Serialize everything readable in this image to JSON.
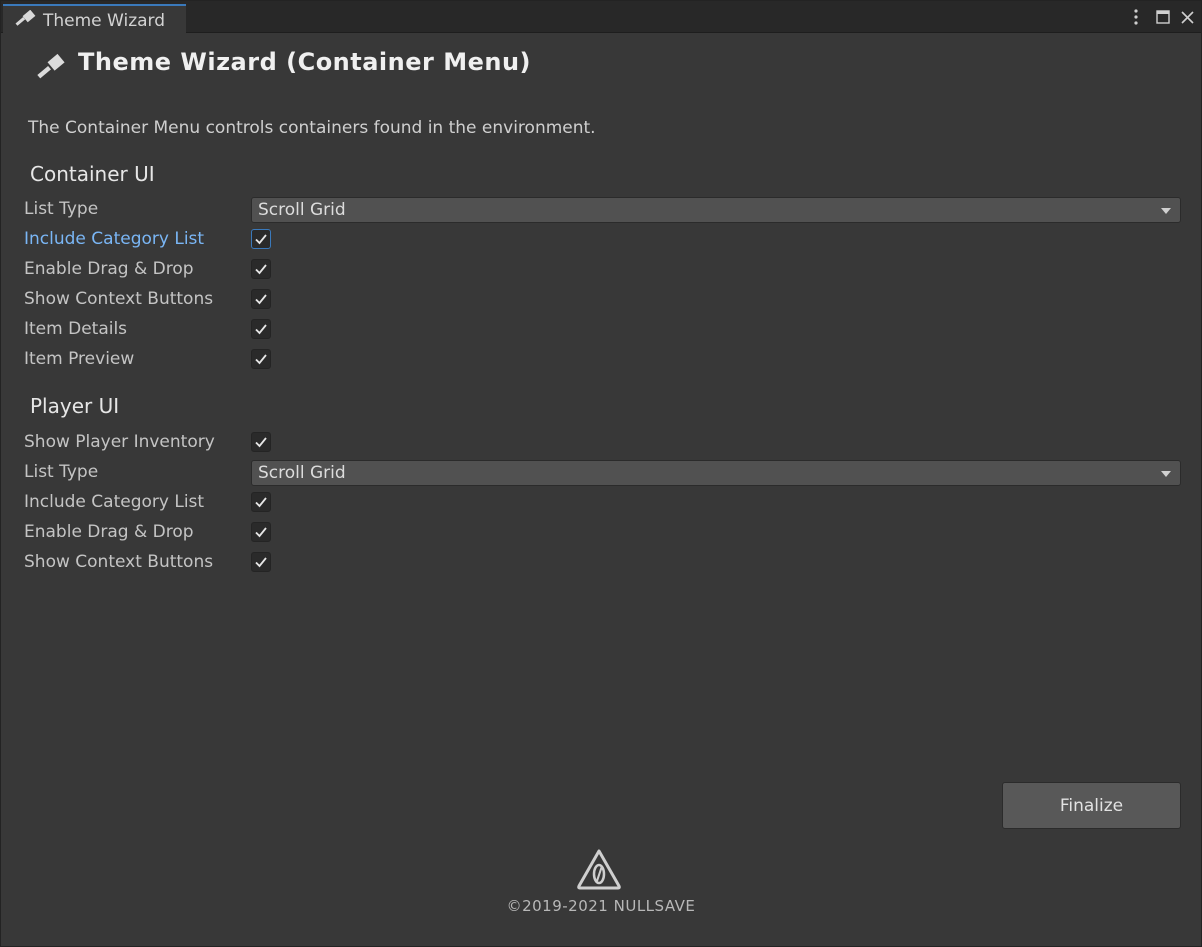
{
  "tab": {
    "label": "Theme Wizard",
    "icon": "paintbrush-icon"
  },
  "window_controls": {
    "menu": "kebab-menu-icon",
    "maximize": "maximize-icon",
    "close": "close-icon"
  },
  "header": {
    "icon": "paintbrush-icon",
    "title": "Theme Wizard (Container Menu)",
    "description": "The Container Menu controls containers found in the environment."
  },
  "container_ui": {
    "title": "Container UI",
    "list_type_label": "List Type",
    "list_type_value": "Scroll Grid",
    "include_category_label": "Include Category List",
    "include_category_checked": true,
    "drag_drop_label": "Enable Drag & Drop",
    "drag_drop_checked": true,
    "context_buttons_label": "Show Context Buttons",
    "context_buttons_checked": true,
    "item_details_label": "Item Details",
    "item_details_checked": true,
    "item_preview_label": "Item Preview",
    "item_preview_checked": true
  },
  "player_ui": {
    "title": "Player UI",
    "show_inventory_label": "Show Player Inventory",
    "show_inventory_checked": true,
    "list_type_label": "List Type",
    "list_type_value": "Scroll Grid",
    "include_category_label": "Include Category List",
    "include_category_checked": true,
    "drag_drop_label": "Enable Drag & Drop",
    "drag_drop_checked": true,
    "context_buttons_label": "Show Context Buttons",
    "context_buttons_checked": true
  },
  "footer": {
    "finalize_label": "Finalize",
    "logo": "nullsave-logo-icon",
    "copyright": "©2019-2021 NULLSAVE"
  },
  "colors": {
    "background": "#383838",
    "accent": "#3a79bb",
    "focused_label": "#7ab6f5"
  }
}
